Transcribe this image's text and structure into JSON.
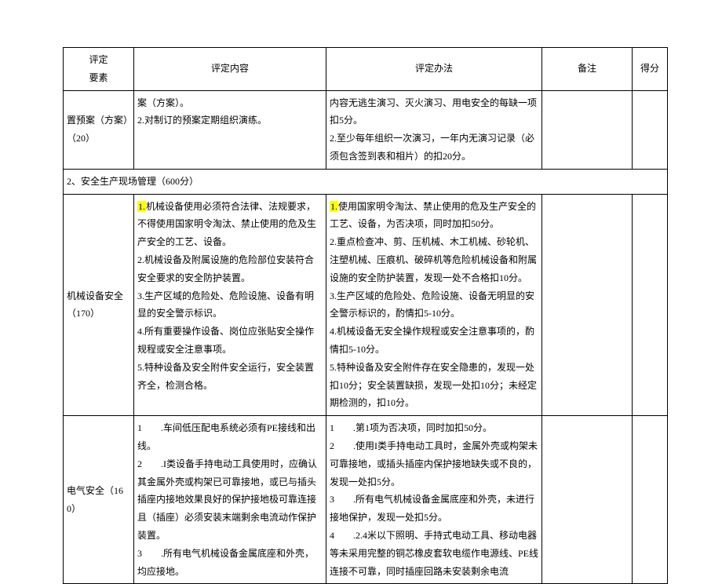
{
  "headers": {
    "element": "评定\n要素",
    "content": "评定内容",
    "method": "评定办法",
    "note": "备注",
    "score": "得分"
  },
  "rows": [
    {
      "element": "置预案（方案）（20）",
      "content": "案（方案）。\n2.对制订的预案定期组织演练。",
      "method": "内容无逃生演习、灭火演习、用电安全的每缺一项扣5分。\n2.至少每年组织一次演习，一年内无演习记录（必须包含签到表和相片）的扣20分。",
      "note": "",
      "score": ""
    }
  ],
  "section": {
    "title": "2、安全生产现场管理（600分）"
  },
  "rows2": [
    {
      "element": "机械设备安全（170）",
      "content_hl_prefix": "1.",
      "content_after_hl": "机械设备使用必须符合法律、法规要求，不得使用国家明令淘汰、禁止使用的危及生产安全的工艺、设备。\n2.机械设备及附属设施的危险部位安装符合安全要求的安全防护装置。\n3.生产区域的危险处、危险设施、设备有明显的安全警示标识。\n4.所有重要操作设备、岗位应张贴安全操作规程或安全注意事项。\n5.特种设备及安全附件安全运行，安全装置齐全，检测合格。",
      "method_hl_prefix": "1.",
      "method_after_hl": "使用国家明令淘汰、禁止使用的危及生产安全的工艺、设备，为否决项，同时加扣50分。\n2.重点检查冲、剪、压机械、木工机械、砂轮机、注塑机械、压痕机、破碎机等危险机械设备和附属设施的安全防护装置，发现一处不合格扣10分。\n3.生产区域的危险处、危险设施、设备无明显的安全警示标识的，酌情扣5-10分。\n4.机械设备无安全操作规程或安全注意事项的，酌情扣5-10分。\n5.特种设备及安全附件存在安全隐患的，发现一处扣10分；安全装置缺损，发现一处扣10分；未经定期检测的，扣10分。",
      "note": "",
      "score": ""
    },
    {
      "element": "电气安全（160）",
      "content": "1　　.车间低压配电系统必须有PE接线和出线。\n2　　.I类设备手持电动工具使用时，应确认其金属外壳或构架已可靠接地，或已与插头插座内接地效果良好的保护接地极可靠连接且（插座）必须安装末端剩余电流动作保护装置。\n3　　.所有电气机械设备金属底座和外壳，均应接地。",
      "method": "1　　.第1项为否决项，同时加扣50分。\n2　　.使用I类手持电动工具时，金属外壳或构架未可靠接地，或插头插座内保护接地缺失或不良的，发现一处扣5分。\n3　　.所有电气机械设备金属底座和外壳，未进行接地保护，发现一处扣5分。\n4　　.2.4米以下照明、手持式电动工具、移动电器等未采用完整的铜芯橡皮套软电缆作电源线、PE线连接不可靠，同时插座回路未安装剩余电流",
      "note": "",
      "score": ""
    }
  ]
}
